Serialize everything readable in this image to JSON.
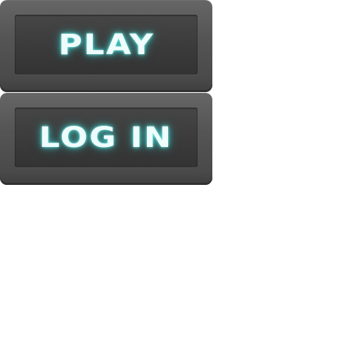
{
  "menu": {
    "buttons": [
      {
        "label": "PLAY"
      },
      {
        "label": "LOG IN"
      }
    ]
  },
  "colors": {
    "button_frame": "#555555",
    "button_face": "#3a3a3a",
    "label_text": "#eefcfc",
    "label_glow": "#46dcd7",
    "background": "#ffffff"
  }
}
